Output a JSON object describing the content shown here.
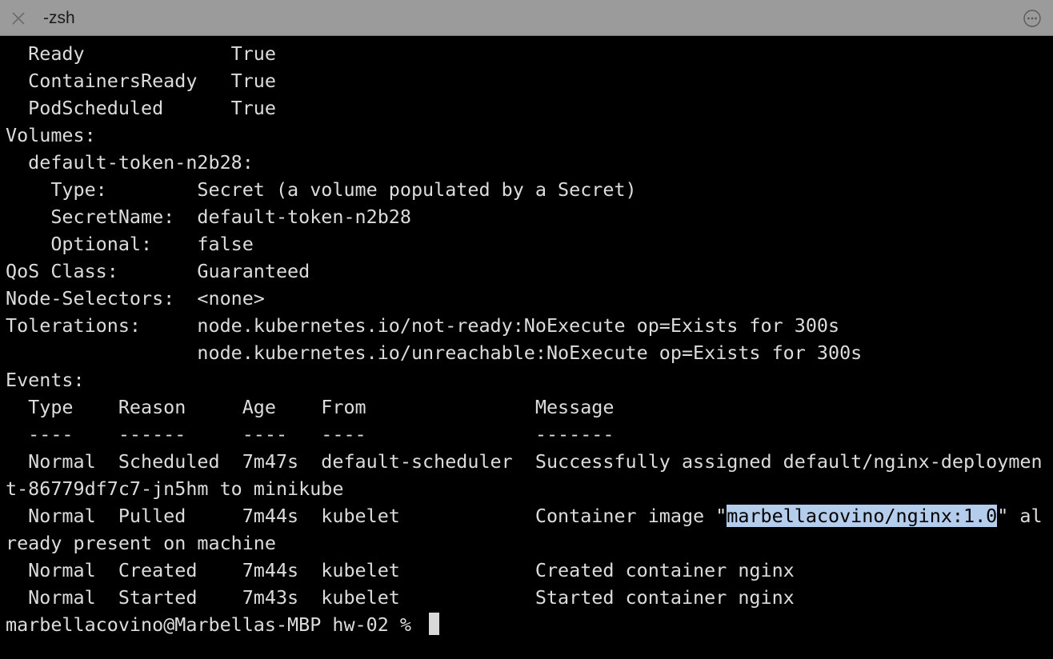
{
  "window": {
    "tab_title": "-zsh",
    "close_icon": "close-icon",
    "more_icon": "ellipsis-circle-icon"
  },
  "terminal": {
    "lines": [
      "  Ready             True",
      "  ContainersReady   True",
      "  PodScheduled      True",
      "Volumes:",
      "  default-token-n2b28:",
      "    Type:        Secret (a volume populated by a Secret)",
      "    SecretName:  default-token-n2b28",
      "    Optional:    false",
      "QoS Class:       Guaranteed",
      "Node-Selectors:  <none>",
      "Tolerations:     node.kubernetes.io/not-ready:NoExecute op=Exists for 300s",
      "                 node.kubernetes.io/unreachable:NoExecute op=Exists for 300s",
      "Events:",
      "  Type    Reason     Age    From               Message",
      "  ----    ------     ----   ----               -------",
      "  Normal  Scheduled  7m47s  default-scheduler  Successfully assigned default/nginx-deploymen",
      "t-86779df7c7-jn5hm to minikube"
    ],
    "pulled_line": {
      "before": "  Normal  Pulled     7m44s  kubelet            Container image \"",
      "selected": "marbellacovino/nginx:1.0",
      "after": "\" al"
    },
    "lines_after": [
      "ready present on machine",
      "  Normal  Created    7m44s  kubelet            Created container nginx",
      "  Normal  Started    7m43s  kubelet            Started container nginx"
    ],
    "prompt": "marbellacovino@Marbellas-MBP hw-02 % "
  },
  "colors": {
    "background": "#000000",
    "text": "#dcdcdc",
    "tabbar": "#9b9b9b",
    "selection": "#b4cdec"
  }
}
